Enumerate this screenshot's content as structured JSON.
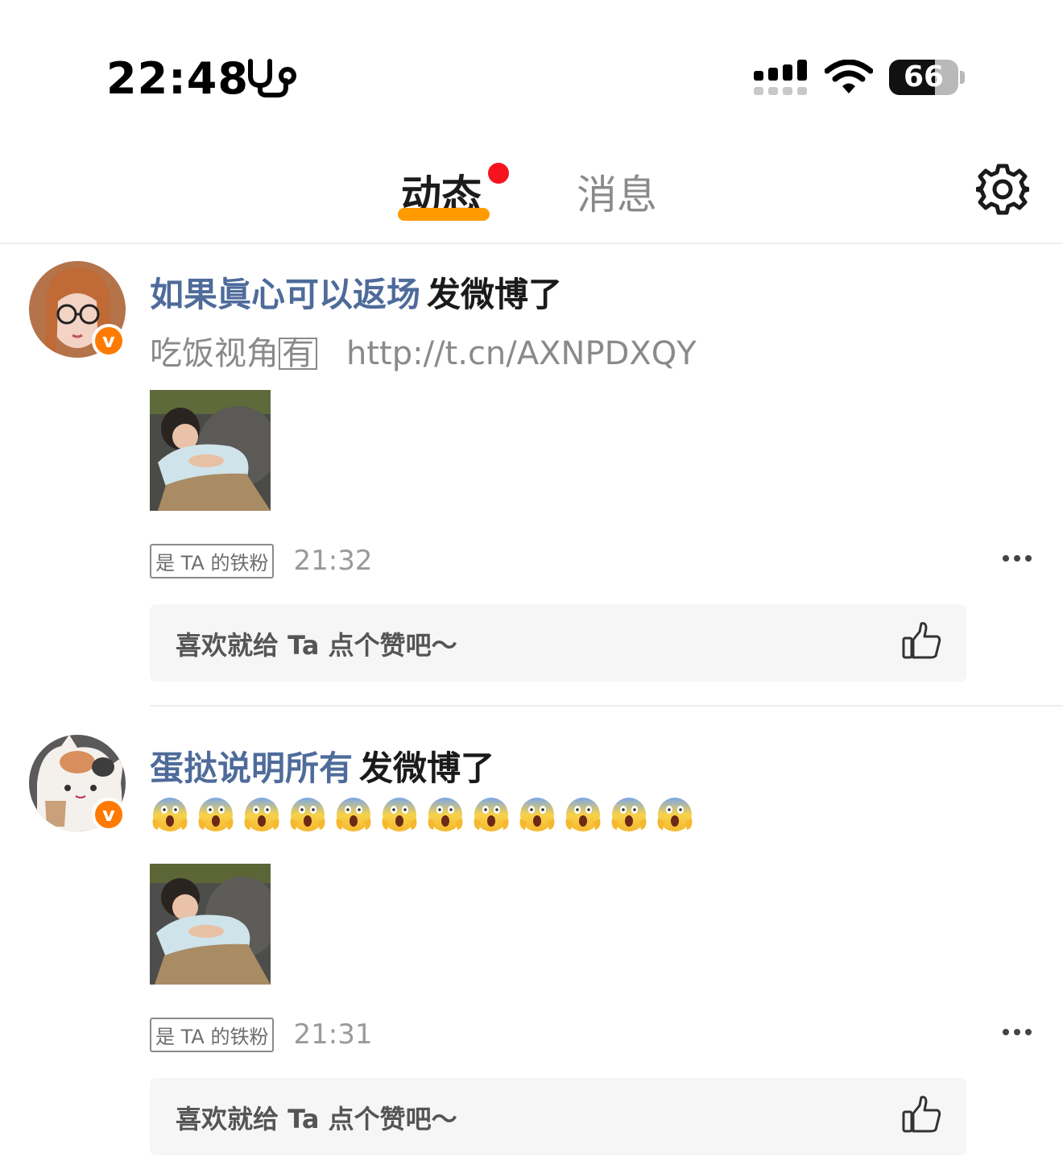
{
  "status_bar": {
    "time": "22:48",
    "battery_level": "66",
    "battery_fraction": 0.66
  },
  "tabs": {
    "active": "动态",
    "inactive": "消息"
  },
  "posts": [
    {
      "author": "如果眞心可以返场",
      "action": "发微博了",
      "text_prefix": "吃饭视角",
      "text_boxed_char": "有",
      "link": "http://t.cn/AXNPDXQY",
      "badge": "是 TA 的铁粉",
      "time": "21:32",
      "like_prompt": "喜欢就给 Ta 点个赞吧～"
    },
    {
      "author": "蛋挞说明所有",
      "action": "发微博了",
      "emoji_count": 12,
      "emoji_name": "screaming-face",
      "badge": "是 TA 的铁粉",
      "time": "21:31",
      "like_prompt": "喜欢就给 Ta 点个赞吧～"
    }
  ],
  "colors": {
    "accent": "#ff9a00",
    "author": "#4e6b9a",
    "notice_dot": "#f5141e",
    "verified": "#ff7a00"
  },
  "icons": [
    "activity-icon",
    "signal-icon",
    "wifi-icon",
    "battery-icon",
    "gear-icon",
    "verified-icon",
    "more-icon",
    "thumbs-up-icon"
  ]
}
